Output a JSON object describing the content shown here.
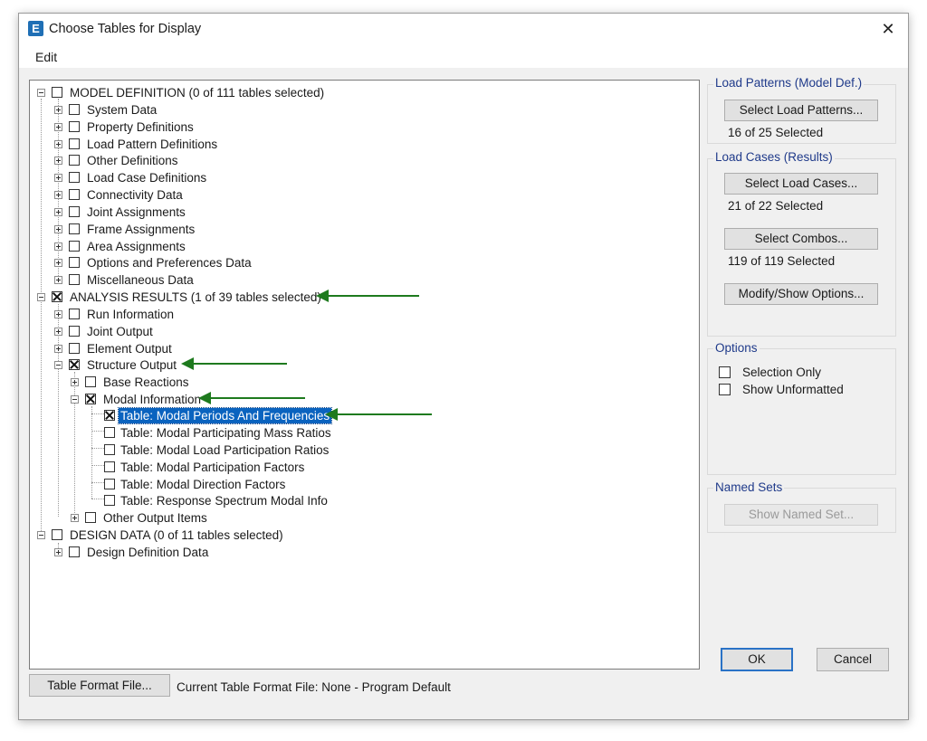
{
  "window": {
    "title": "Choose Tables for Display",
    "app_icon": "E",
    "close_glyph": "✕"
  },
  "menu": {
    "edit": "Edit"
  },
  "tree": {
    "model_definition": {
      "label": "MODEL DEFINITION (0 of 111 tables selected)",
      "children": [
        "System Data",
        "Property Definitions",
        "Load Pattern Definitions",
        "Other Definitions",
        "Load Case Definitions",
        "Connectivity Data",
        "Joint Assignments",
        "Frame Assignments",
        "Area Assignments",
        "Options and Preferences Data",
        "Miscellaneous Data"
      ]
    },
    "analysis_results": {
      "label": "ANALYSIS RESULTS (1 of 39 tables selected)",
      "children": [
        "Run Information",
        "Joint Output",
        "Element Output"
      ],
      "structure_output": {
        "label": "Structure Output",
        "base_reactions": "Base Reactions",
        "modal_information": {
          "label": "Modal Information",
          "tables": [
            "Table: Modal Periods And Frequencies",
            "Table: Modal Participating Mass Ratios",
            "Table: Modal Load Participation Ratios",
            "Table: Modal Participation Factors",
            "Table: Modal Direction Factors",
            "Table: Response Spectrum Modal Info"
          ]
        },
        "other_output_items": "Other Output Items"
      }
    },
    "design_data": {
      "label": "DESIGN DATA  (0 of 11 tables selected)",
      "children": [
        "Design Definition Data"
      ]
    }
  },
  "right": {
    "load_patterns": {
      "title": "Load Patterns (Model Def.)",
      "button": "Select Load Patterns...",
      "status": "16 of 25 Selected"
    },
    "load_cases": {
      "title": "Load Cases (Results)",
      "cases_button": "Select Load Cases...",
      "cases_status": "21 of 22 Selected",
      "combos_button": "Select Combos...",
      "combos_status": "119 of 119 Selected",
      "options_button": "Modify/Show Options..."
    },
    "options": {
      "title": "Options",
      "selection_only": "Selection Only",
      "show_unformatted": "Show Unformatted"
    },
    "named_sets": {
      "title": "Named Sets",
      "button": "Show Named Set..."
    }
  },
  "footer": {
    "format_button": "Table Format File...",
    "format_label": "Current Table Format File:  None - Program Default",
    "ok": "OK",
    "cancel": "Cancel"
  },
  "colors": {
    "arrow": "#1e7a1e",
    "selection": "#0a63bf",
    "group_title": "#1f3a8a"
  }
}
